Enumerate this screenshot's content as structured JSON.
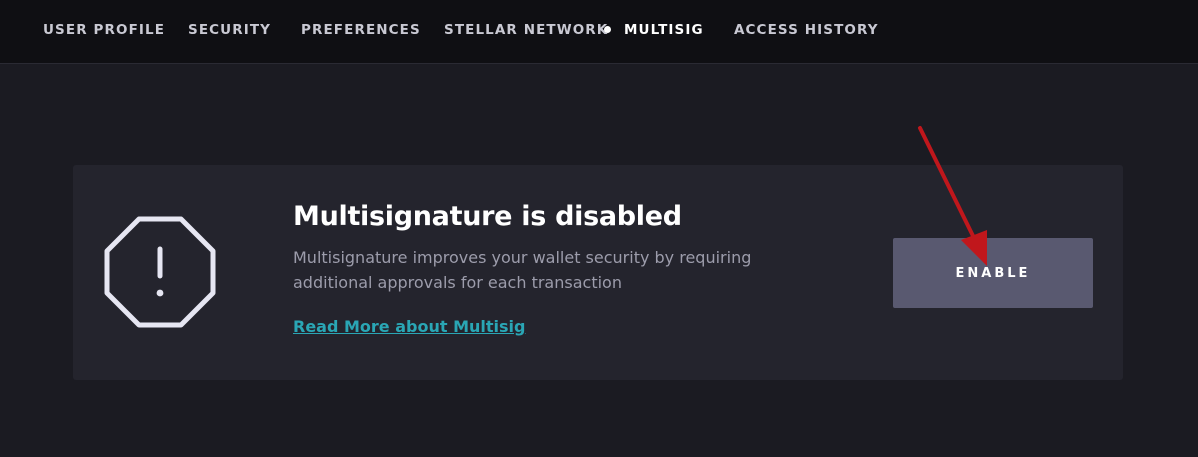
{
  "nav": {
    "items": [
      {
        "label": "USER PROFILE",
        "active": false
      },
      {
        "label": "SECURITY",
        "active": false
      },
      {
        "label": "PREFERENCES",
        "active": false
      },
      {
        "label": "STELLAR NETWORK",
        "active": false
      },
      {
        "label": "MULTISIG",
        "active": true
      },
      {
        "label": "ACCESS HISTORY",
        "active": false
      }
    ]
  },
  "card": {
    "icon": "octagon-warning-icon",
    "title": "Multisignature is disabled",
    "description": "Multisignature improves your wallet security by requiring additional approvals for each transaction",
    "link_label": "Read More about Multisig",
    "button_label": "ENABLE"
  },
  "annotation": {
    "icon": "red-arrow-icon",
    "color": "#c0171c"
  },
  "colors": {
    "background": "#1b1b22",
    "nav_background": "#0f0f13",
    "card_background": "#24242d",
    "button_background": "#595970",
    "link": "#2aa6b5"
  }
}
